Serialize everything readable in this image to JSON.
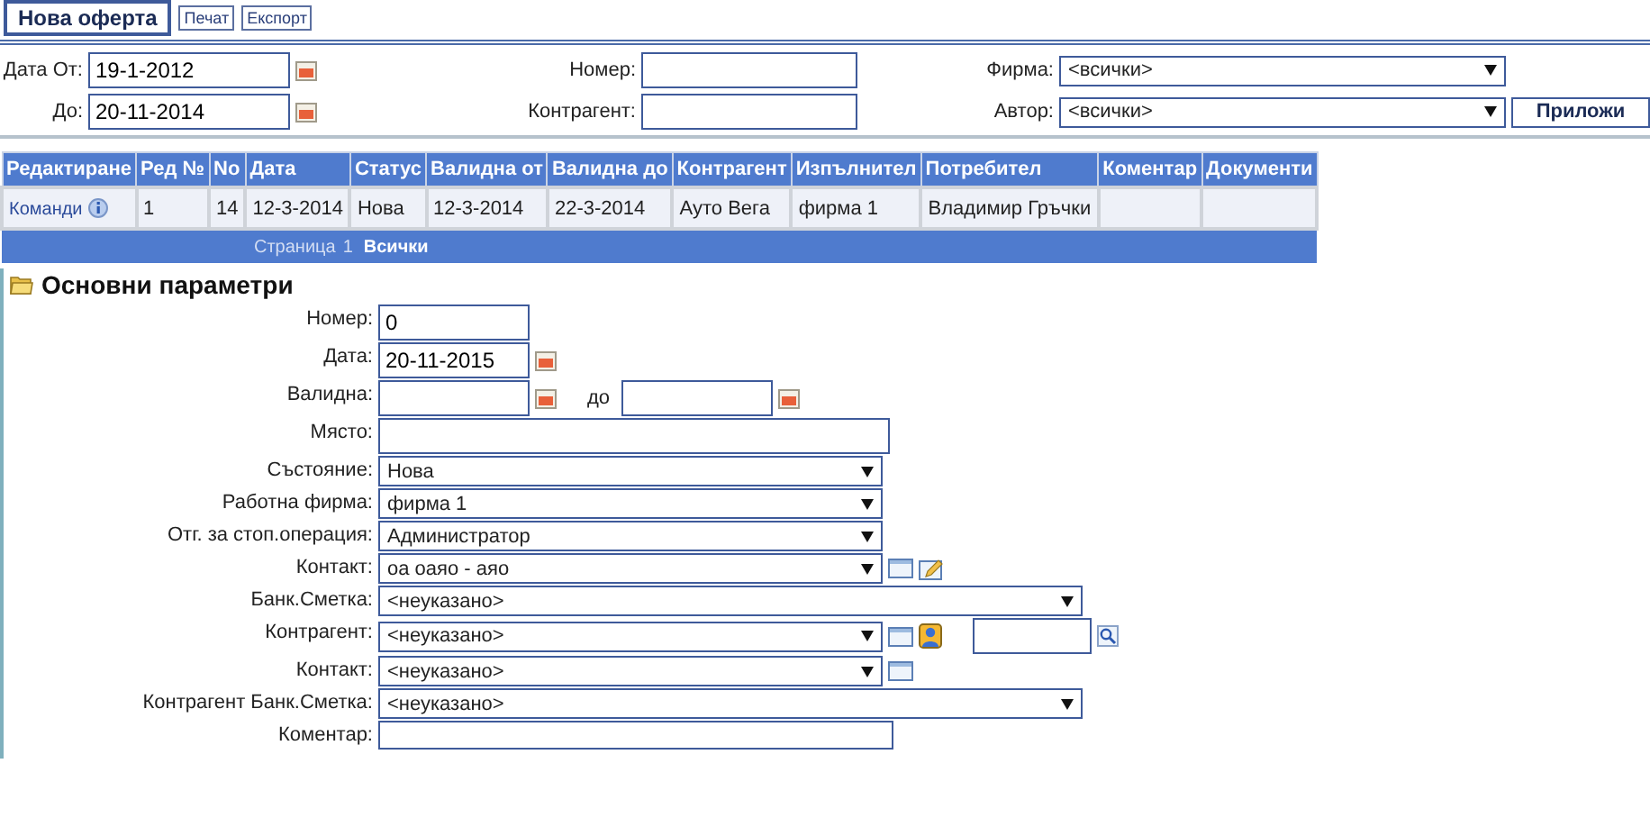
{
  "toolbar": [
    {
      "label": "Нова оферта",
      "kind": "primary"
    },
    {
      "label": "Печат",
      "kind": "small"
    },
    {
      "label": "Експорт",
      "kind": "small"
    }
  ],
  "filters": {
    "date_from": {
      "label": "Дата От:",
      "value": "19-1-2012"
    },
    "date_to": {
      "label": "До:",
      "value": "20-11-2014"
    },
    "number": {
      "label": "Номер:"
    },
    "contractor": {
      "label": "Контрагент:"
    },
    "company": {
      "label": "Фирма:",
      "value": "<всички>"
    },
    "author": {
      "label": "Автор:",
      "value": "<всички>"
    },
    "apply": "Приложи"
  },
  "table": {
    "columns": [
      "Редактиране",
      "Ред №",
      "No",
      "Дата",
      "Статус",
      "Валидна от",
      "Валидна до",
      "Контрагент",
      "Изпълнител",
      "Потребител",
      "Коментар",
      "Документи"
    ],
    "rows": [
      {
        "cells": [
          "Команди",
          "1",
          "14",
          "12-3-2014",
          "Нова",
          "12-3-2014",
          "22-3-2014",
          "Ауто Вега",
          "фирма 1",
          "Владимир Гръчки",
          "",
          ""
        ]
      }
    ],
    "pager": {
      "label": "Страница",
      "pages": [
        {
          "label": "1",
          "selected": true
        },
        {
          "label": "Всички",
          "selected": false
        }
      ]
    }
  },
  "section": {
    "title": "Основни параметри",
    "fields": [
      {
        "label": "Номер:",
        "kind": "text",
        "value": "0"
      },
      {
        "label": "Дата:",
        "kind": "date",
        "value": "20-11-2015"
      },
      {
        "label": "Валидна:",
        "kind": "range",
        "to_label": "до"
      },
      {
        "label": "Място:",
        "kind": "wide-text"
      },
      {
        "label": "Състояние:",
        "kind": "select",
        "value": "Нова"
      },
      {
        "label": "Работна фирма:",
        "kind": "select",
        "value": "фирма 1"
      },
      {
        "label": "Отг. за стоп.операция:",
        "kind": "select",
        "value": "Администратор"
      },
      {
        "label": "Контакт:",
        "kind": "select",
        "value": "оа оаяо - аяо",
        "tools": [
          {
            "kind": "card"
          },
          {
            "kind": "edit"
          }
        ]
      },
      {
        "label": "Банк.Сметка:",
        "kind": "wide-select",
        "value": "<неуказано>"
      },
      {
        "label": "Контрагент:",
        "kind": "select",
        "value": "<неуказано>",
        "tools": [
          {
            "kind": "card"
          },
          {
            "kind": "person"
          },
          {
            "kind": "search"
          }
        ]
      },
      {
        "label": "Контакт:",
        "kind": "select",
        "value": "<неуказано>",
        "tools": [
          {
            "kind": "card"
          }
        ]
      },
      {
        "label": "Контрагент Банк.Сметка:",
        "kind": "wide-select",
        "value": "<неуказано>"
      },
      {
        "label": "Коментар:",
        "kind": "textarea"
      }
    ]
  }
}
